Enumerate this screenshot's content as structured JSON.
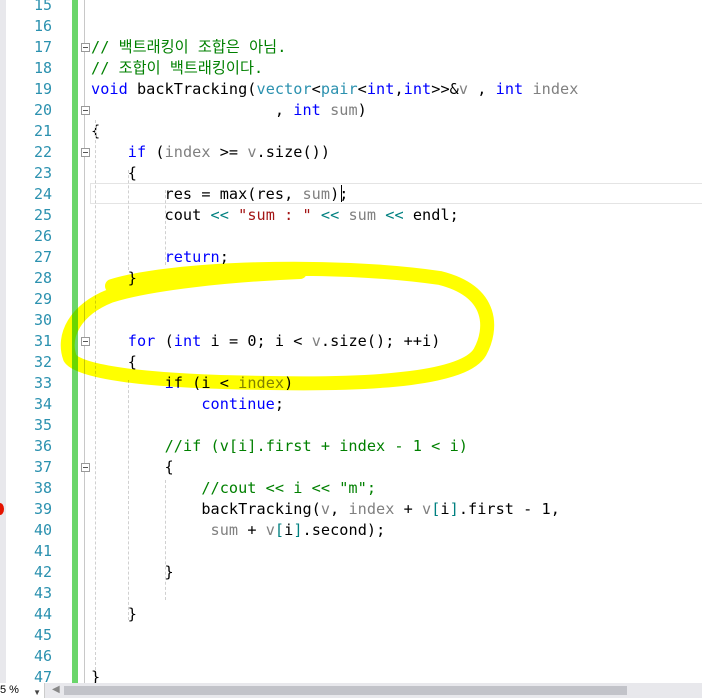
{
  "editor": {
    "zoom_label": "5 %",
    "colors": {
      "keyword": "#0000ff",
      "type": "#2b91af",
      "param": "#808080",
      "comment": "#008000",
      "string": "#a31515",
      "highlighter": "#ffff00",
      "change_bar": "#6ad66a"
    },
    "lines": [
      {
        "n": "15",
        "tokens": []
      },
      {
        "n": "16",
        "tokens": []
      },
      {
        "n": "17",
        "tokens": [
          {
            "c": "cm",
            "t": "// 백트래킹이 조합은 아님."
          }
        ]
      },
      {
        "n": "18",
        "tokens": [
          {
            "c": "cm",
            "t": "// 조합이 백트래킹이다."
          }
        ]
      },
      {
        "n": "19",
        "tokens": [
          {
            "c": "kw",
            "t": "void"
          },
          {
            "c": "",
            "t": " backTracking("
          },
          {
            "c": "ty",
            "t": "vector"
          },
          {
            "c": "",
            "t": "<"
          },
          {
            "c": "ty",
            "t": "pair"
          },
          {
            "c": "",
            "t": "<"
          },
          {
            "c": "kw",
            "t": "int"
          },
          {
            "c": "",
            "t": ","
          },
          {
            "c": "kw",
            "t": "int"
          },
          {
            "c": "",
            "t": ">>&"
          },
          {
            "c": "pm",
            "t": "v"
          },
          {
            "c": "",
            "t": " , "
          },
          {
            "c": "kw",
            "t": "int"
          },
          {
            "c": "",
            "t": " "
          },
          {
            "c": "pm",
            "t": "index"
          }
        ]
      },
      {
        "n": "20",
        "tokens": [
          {
            "c": "",
            "t": "                    , "
          },
          {
            "c": "kw",
            "t": "int"
          },
          {
            "c": "",
            "t": " "
          },
          {
            "c": "pm",
            "t": "sum"
          },
          {
            "c": "",
            "t": ")"
          }
        ]
      },
      {
        "n": "21",
        "tokens": [
          {
            "c": "",
            "t": "{"
          }
        ]
      },
      {
        "n": "22",
        "tokens": [
          {
            "c": "",
            "t": "    "
          },
          {
            "c": "kw",
            "t": "if"
          },
          {
            "c": "",
            "t": " ("
          },
          {
            "c": "pm",
            "t": "index"
          },
          {
            "c": "",
            "t": " >= "
          },
          {
            "c": "pm",
            "t": "v"
          },
          {
            "c": "",
            "t": ".size())"
          }
        ]
      },
      {
        "n": "23",
        "tokens": [
          {
            "c": "",
            "t": "    {"
          }
        ]
      },
      {
        "n": "24",
        "tokens": [
          {
            "c": "",
            "t": "        res = max(res, "
          },
          {
            "c": "pm",
            "t": "sum"
          },
          {
            "c": "",
            "t": ");"
          }
        ]
      },
      {
        "n": "25",
        "tokens": [
          {
            "c": "",
            "t": "        cout "
          },
          {
            "c": "op",
            "t": "<<"
          },
          {
            "c": "",
            "t": " "
          },
          {
            "c": "st",
            "t": "\"sum : \""
          },
          {
            "c": "",
            "t": " "
          },
          {
            "c": "op",
            "t": "<<"
          },
          {
            "c": "",
            "t": " "
          },
          {
            "c": "pm",
            "t": "sum"
          },
          {
            "c": "",
            "t": " "
          },
          {
            "c": "op",
            "t": "<<"
          },
          {
            "c": "",
            "t": " endl;"
          }
        ]
      },
      {
        "n": "26",
        "tokens": []
      },
      {
        "n": "27",
        "tokens": [
          {
            "c": "",
            "t": "        "
          },
          {
            "c": "kw",
            "t": "return"
          },
          {
            "c": "",
            "t": ";"
          }
        ]
      },
      {
        "n": "28",
        "tokens": [
          {
            "c": "",
            "t": "    }"
          }
        ]
      },
      {
        "n": "29",
        "tokens": []
      },
      {
        "n": "30",
        "tokens": []
      },
      {
        "n": "31",
        "tokens": [
          {
            "c": "",
            "t": "    "
          },
          {
            "c": "kw",
            "t": "for"
          },
          {
            "c": "",
            "t": " ("
          },
          {
            "c": "kw",
            "t": "int"
          },
          {
            "c": "",
            "t": " i = 0; i < "
          },
          {
            "c": "pm",
            "t": "v"
          },
          {
            "c": "",
            "t": ".size(); ++i)"
          }
        ]
      },
      {
        "n": "32",
        "tokens": [
          {
            "c": "",
            "t": "    {"
          }
        ]
      },
      {
        "n": "33",
        "tokens": [
          {
            "c": "",
            "t": "        "
          },
          {
            "c": "kw",
            "t": "if"
          },
          {
            "c": "",
            "t": " (i < "
          },
          {
            "c": "pm",
            "t": "index"
          },
          {
            "c": "",
            "t": ")"
          }
        ]
      },
      {
        "n": "34",
        "tokens": [
          {
            "c": "",
            "t": "            "
          },
          {
            "c": "kw",
            "t": "continue"
          },
          {
            "c": "",
            "t": ";"
          }
        ]
      },
      {
        "n": "35",
        "tokens": []
      },
      {
        "n": "36",
        "tokens": [
          {
            "c": "",
            "t": "        "
          },
          {
            "c": "cm",
            "t": "//if (v[i].first + index - 1 < i)"
          }
        ]
      },
      {
        "n": "37",
        "tokens": [
          {
            "c": "",
            "t": "        {"
          }
        ]
      },
      {
        "n": "38",
        "tokens": [
          {
            "c": "",
            "t": "            "
          },
          {
            "c": "cm",
            "t": "//cout << i << \"m\";"
          }
        ]
      },
      {
        "n": "39",
        "tokens": [
          {
            "c": "",
            "t": "            backTracking("
          },
          {
            "c": "pm",
            "t": "v"
          },
          {
            "c": "",
            "t": ", "
          },
          {
            "c": "pm",
            "t": "index"
          },
          {
            "c": "",
            "t": " + "
          },
          {
            "c": "pm",
            "t": "v"
          },
          {
            "c": "op",
            "t": "["
          },
          {
            "c": "",
            "t": "i"
          },
          {
            "c": "op",
            "t": "]"
          },
          {
            "c": "",
            "t": ".first - 1,"
          }
        ]
      },
      {
        "n": "40",
        "tokens": [
          {
            "c": "",
            "t": "             "
          },
          {
            "c": "pm",
            "t": "sum"
          },
          {
            "c": "",
            "t": " + "
          },
          {
            "c": "pm",
            "t": "v"
          },
          {
            "c": "op",
            "t": "["
          },
          {
            "c": "",
            "t": "i"
          },
          {
            "c": "op",
            "t": "]"
          },
          {
            "c": "",
            "t": ".second);"
          }
        ]
      },
      {
        "n": "41",
        "tokens": []
      },
      {
        "n": "42",
        "tokens": [
          {
            "c": "",
            "t": "        }"
          }
        ]
      },
      {
        "n": "43",
        "tokens": []
      },
      {
        "n": "44",
        "tokens": [
          {
            "c": "",
            "t": "    }"
          }
        ]
      },
      {
        "n": "45",
        "tokens": []
      },
      {
        "n": "46",
        "tokens": []
      },
      {
        "n": "47",
        "tokens": [
          {
            "c": "",
            "t": "}"
          }
        ]
      }
    ]
  }
}
